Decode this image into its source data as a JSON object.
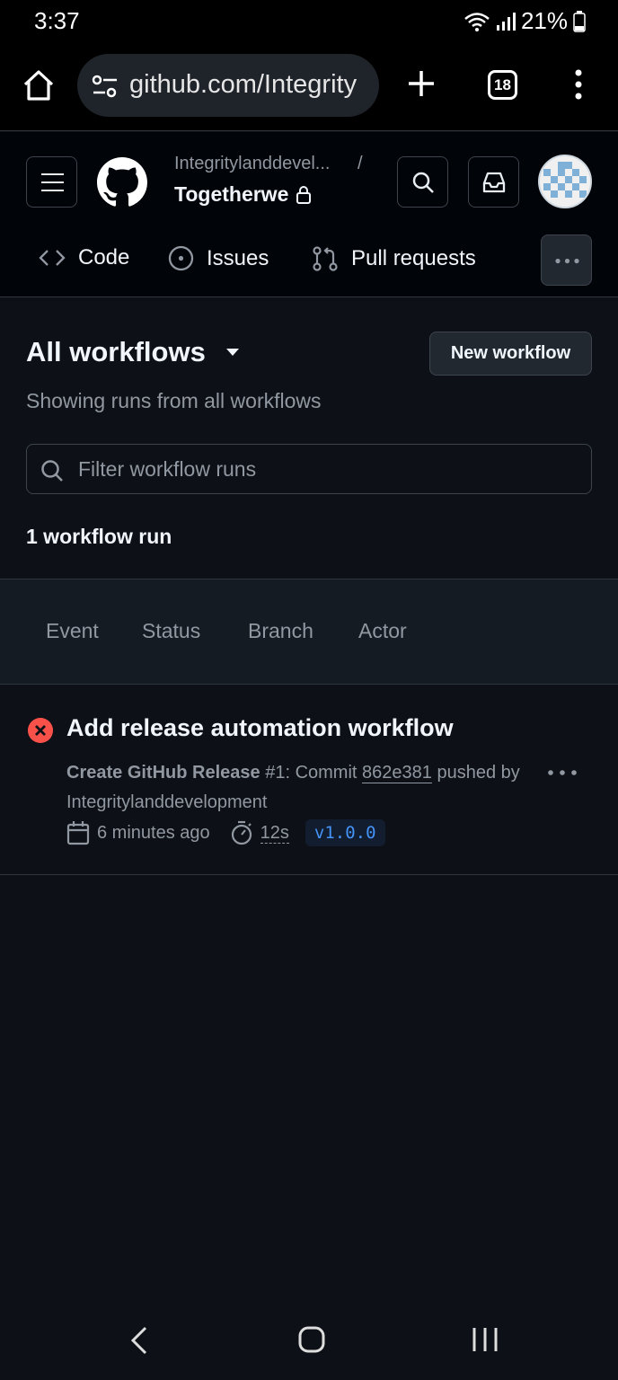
{
  "status": {
    "time": "3:37",
    "battery": "21%"
  },
  "browser": {
    "url": "github.com/Integrity",
    "tab_count": "18"
  },
  "repo": {
    "owner": "Integritylanddevel...",
    "separator": "/",
    "name": "Togetherwe"
  },
  "nav": {
    "code": "Code",
    "issues": "Issues",
    "pulls": "Pull requests"
  },
  "workflows": {
    "title": "All workflows",
    "new_button": "New workflow",
    "subtitle": "Showing runs from all workflows",
    "filter_placeholder": "Filter workflow runs",
    "run_count": "1 workflow run"
  },
  "filters": [
    "Event",
    "Status",
    "Branch",
    "Actor"
  ],
  "run": {
    "title": "Add release automation workflow",
    "workflow_name": "Create GitHub Release",
    "run_number": "#1",
    "commit_prefix": ": Commit",
    "sha": "862e381",
    "pushed_by": "pushed by",
    "actor": "Integritylanddevelopment",
    "time_ago": "6 minutes ago",
    "duration": "12s",
    "branch": "v1.0.0",
    "status": "failure"
  },
  "colors": {
    "accent": "#4493f8",
    "failure": "#f85149",
    "notification": "#1f6feb"
  }
}
